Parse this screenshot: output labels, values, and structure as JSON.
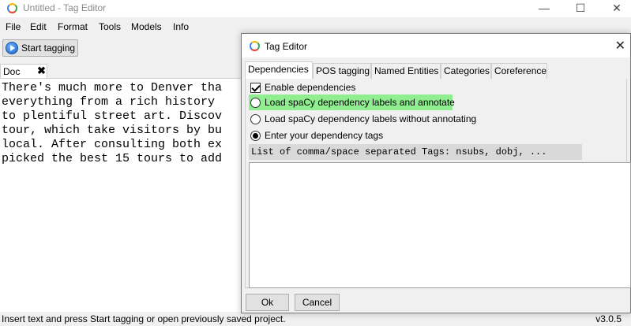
{
  "main_window": {
    "title": "Untitled - Tag Editor",
    "minimize": "—",
    "maximize": "☐",
    "close": "✕"
  },
  "menu": [
    "File",
    "Edit",
    "Format",
    "Tools",
    "Models",
    "Info"
  ],
  "toolbar": {
    "start_label": "Start tagging"
  },
  "doc_tab": {
    "label": "Doc",
    "close": "✖"
  },
  "document": {
    "text": "There's much more to Denver tha\neverything from a rich history \nto plentiful street art. Discov\ntour, which take visitors by bu\nlocal. After consulting both ex\npicked the best 15 tours to add"
  },
  "status": {
    "message": "Insert text and press Start tagging or open previously saved project.",
    "version": "v3.0.5"
  },
  "dialog": {
    "title": "Tag Editor",
    "close": "✕",
    "tabs": [
      "Dependencies",
      "POS tagging",
      "Named Entities",
      "Categories",
      "Coreference"
    ],
    "active_tab": 0,
    "enable_label": "Enable dependencies",
    "enable_checked": true,
    "options": [
      {
        "label": "Load spaCy dependency labels and annotate",
        "checked": false,
        "highlighted": true
      },
      {
        "label": "Load spaCy dependency labels without annotating",
        "checked": false,
        "highlighted": false
      },
      {
        "label": "Enter your dependency tags",
        "checked": true,
        "highlighted": false
      }
    ],
    "entry_label": "List of comma/space separated Tags: nsubs, dobj, ...",
    "entry_value": "",
    "ok_label": "Ok",
    "cancel_label": "Cancel",
    "highlight_color": "#90ee90"
  }
}
